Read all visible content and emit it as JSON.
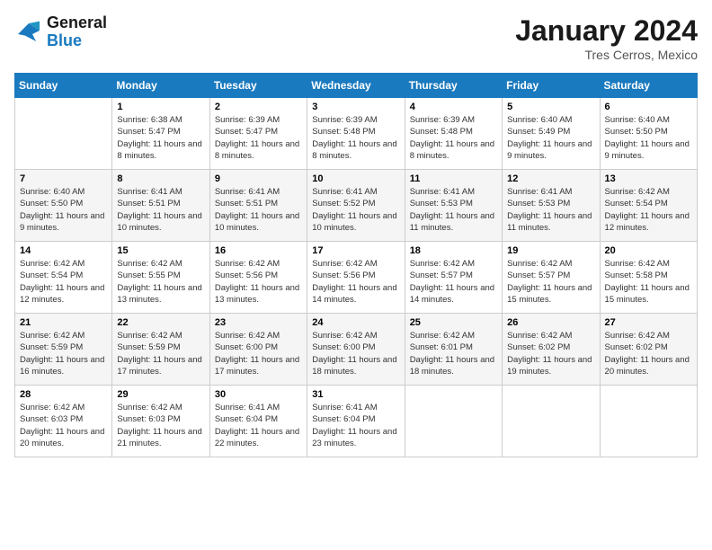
{
  "logo": {
    "line1": "General",
    "line2": "Blue"
  },
  "title": "January 2024",
  "location": "Tres Cerros, Mexico",
  "days_header": [
    "Sunday",
    "Monday",
    "Tuesday",
    "Wednesday",
    "Thursday",
    "Friday",
    "Saturday"
  ],
  "weeks": [
    [
      {
        "day": "",
        "info": ""
      },
      {
        "day": "1",
        "info": "Sunrise: 6:38 AM\nSunset: 5:47 PM\nDaylight: 11 hours and 8 minutes."
      },
      {
        "day": "2",
        "info": "Sunrise: 6:39 AM\nSunset: 5:47 PM\nDaylight: 11 hours and 8 minutes."
      },
      {
        "day": "3",
        "info": "Sunrise: 6:39 AM\nSunset: 5:48 PM\nDaylight: 11 hours and 8 minutes."
      },
      {
        "day": "4",
        "info": "Sunrise: 6:39 AM\nSunset: 5:48 PM\nDaylight: 11 hours and 8 minutes."
      },
      {
        "day": "5",
        "info": "Sunrise: 6:40 AM\nSunset: 5:49 PM\nDaylight: 11 hours and 9 minutes."
      },
      {
        "day": "6",
        "info": "Sunrise: 6:40 AM\nSunset: 5:50 PM\nDaylight: 11 hours and 9 minutes."
      }
    ],
    [
      {
        "day": "7",
        "info": "Sunrise: 6:40 AM\nSunset: 5:50 PM\nDaylight: 11 hours and 9 minutes."
      },
      {
        "day": "8",
        "info": "Sunrise: 6:41 AM\nSunset: 5:51 PM\nDaylight: 11 hours and 10 minutes."
      },
      {
        "day": "9",
        "info": "Sunrise: 6:41 AM\nSunset: 5:51 PM\nDaylight: 11 hours and 10 minutes."
      },
      {
        "day": "10",
        "info": "Sunrise: 6:41 AM\nSunset: 5:52 PM\nDaylight: 11 hours and 10 minutes."
      },
      {
        "day": "11",
        "info": "Sunrise: 6:41 AM\nSunset: 5:53 PM\nDaylight: 11 hours and 11 minutes."
      },
      {
        "day": "12",
        "info": "Sunrise: 6:41 AM\nSunset: 5:53 PM\nDaylight: 11 hours and 11 minutes."
      },
      {
        "day": "13",
        "info": "Sunrise: 6:42 AM\nSunset: 5:54 PM\nDaylight: 11 hours and 12 minutes."
      }
    ],
    [
      {
        "day": "14",
        "info": "Sunrise: 6:42 AM\nSunset: 5:54 PM\nDaylight: 11 hours and 12 minutes."
      },
      {
        "day": "15",
        "info": "Sunrise: 6:42 AM\nSunset: 5:55 PM\nDaylight: 11 hours and 13 minutes."
      },
      {
        "day": "16",
        "info": "Sunrise: 6:42 AM\nSunset: 5:56 PM\nDaylight: 11 hours and 13 minutes."
      },
      {
        "day": "17",
        "info": "Sunrise: 6:42 AM\nSunset: 5:56 PM\nDaylight: 11 hours and 14 minutes."
      },
      {
        "day": "18",
        "info": "Sunrise: 6:42 AM\nSunset: 5:57 PM\nDaylight: 11 hours and 14 minutes."
      },
      {
        "day": "19",
        "info": "Sunrise: 6:42 AM\nSunset: 5:57 PM\nDaylight: 11 hours and 15 minutes."
      },
      {
        "day": "20",
        "info": "Sunrise: 6:42 AM\nSunset: 5:58 PM\nDaylight: 11 hours and 15 minutes."
      }
    ],
    [
      {
        "day": "21",
        "info": "Sunrise: 6:42 AM\nSunset: 5:59 PM\nDaylight: 11 hours and 16 minutes."
      },
      {
        "day": "22",
        "info": "Sunrise: 6:42 AM\nSunset: 5:59 PM\nDaylight: 11 hours and 17 minutes."
      },
      {
        "day": "23",
        "info": "Sunrise: 6:42 AM\nSunset: 6:00 PM\nDaylight: 11 hours and 17 minutes."
      },
      {
        "day": "24",
        "info": "Sunrise: 6:42 AM\nSunset: 6:00 PM\nDaylight: 11 hours and 18 minutes."
      },
      {
        "day": "25",
        "info": "Sunrise: 6:42 AM\nSunset: 6:01 PM\nDaylight: 11 hours and 18 minutes."
      },
      {
        "day": "26",
        "info": "Sunrise: 6:42 AM\nSunset: 6:02 PM\nDaylight: 11 hours and 19 minutes."
      },
      {
        "day": "27",
        "info": "Sunrise: 6:42 AM\nSunset: 6:02 PM\nDaylight: 11 hours and 20 minutes."
      }
    ],
    [
      {
        "day": "28",
        "info": "Sunrise: 6:42 AM\nSunset: 6:03 PM\nDaylight: 11 hours and 20 minutes."
      },
      {
        "day": "29",
        "info": "Sunrise: 6:42 AM\nSunset: 6:03 PM\nDaylight: 11 hours and 21 minutes."
      },
      {
        "day": "30",
        "info": "Sunrise: 6:41 AM\nSunset: 6:04 PM\nDaylight: 11 hours and 22 minutes."
      },
      {
        "day": "31",
        "info": "Sunrise: 6:41 AM\nSunset: 6:04 PM\nDaylight: 11 hours and 23 minutes."
      },
      {
        "day": "",
        "info": ""
      },
      {
        "day": "",
        "info": ""
      },
      {
        "day": "",
        "info": ""
      }
    ]
  ]
}
